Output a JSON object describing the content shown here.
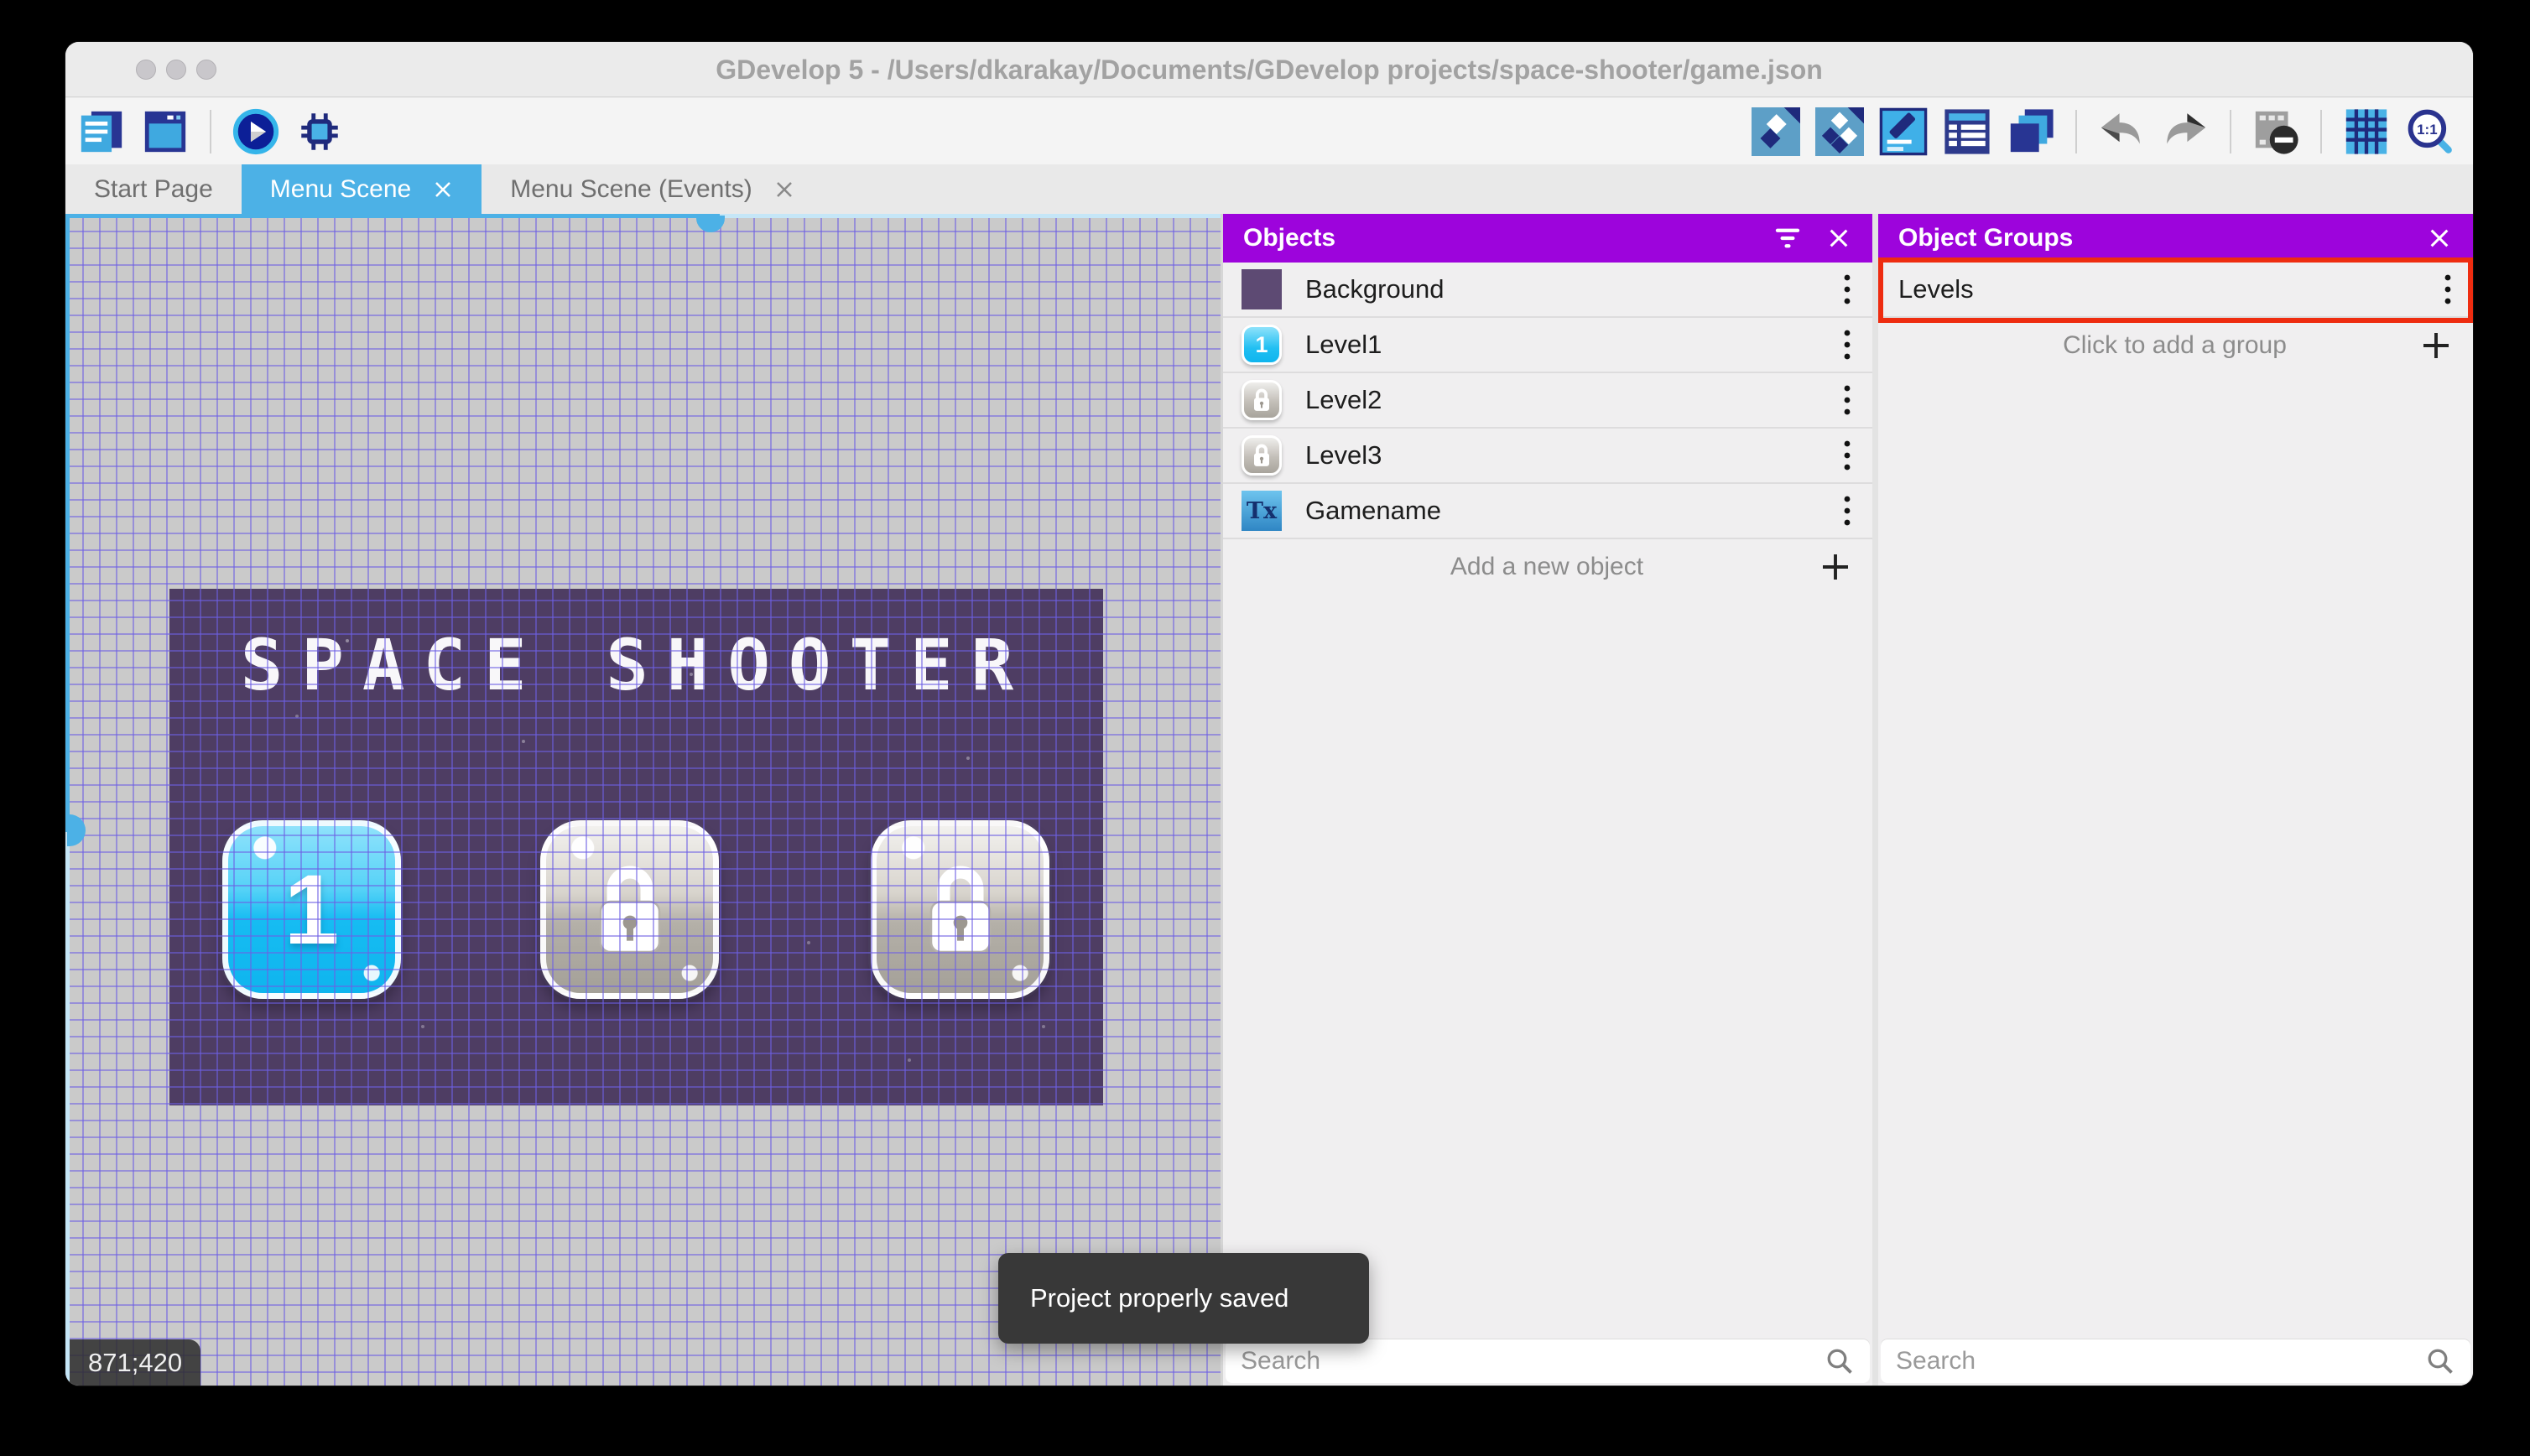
{
  "window": {
    "title": "GDevelop 5 - /Users/dkarakay/Documents/GDevelop projects/space-shooter/game.json"
  },
  "toolbar": {
    "zoom_ratio_label": "1:1"
  },
  "tabs": [
    {
      "label": "Start Page"
    },
    {
      "label": "Menu Scene"
    },
    {
      "label": "Menu Scene (Events)"
    }
  ],
  "canvas": {
    "game_title": "SPACE SHOOTER",
    "level_button_label": "1",
    "coordinates": "871;420"
  },
  "objects_panel": {
    "title": "Objects",
    "items": [
      {
        "name": "Background"
      },
      {
        "name": "Level1",
        "thumb_label": "1"
      },
      {
        "name": "Level2"
      },
      {
        "name": "Level3"
      },
      {
        "name": "Gamename",
        "thumb_label": "Tx"
      }
    ],
    "add_label": "Add a new object",
    "search_placeholder": "Search"
  },
  "object_groups_panel": {
    "title": "Object Groups",
    "groups": [
      {
        "name": "Levels"
      }
    ],
    "add_label": "Click to add a group",
    "search_placeholder": "Search"
  },
  "toast": {
    "message": "Project properly saved"
  },
  "colors": {
    "accent_blue": "#4cb1e6",
    "panel_header_purple": "#9d04dc",
    "highlight_red": "#ee2c10",
    "game_background": "#4e3d63",
    "toast_background": "#383838"
  }
}
